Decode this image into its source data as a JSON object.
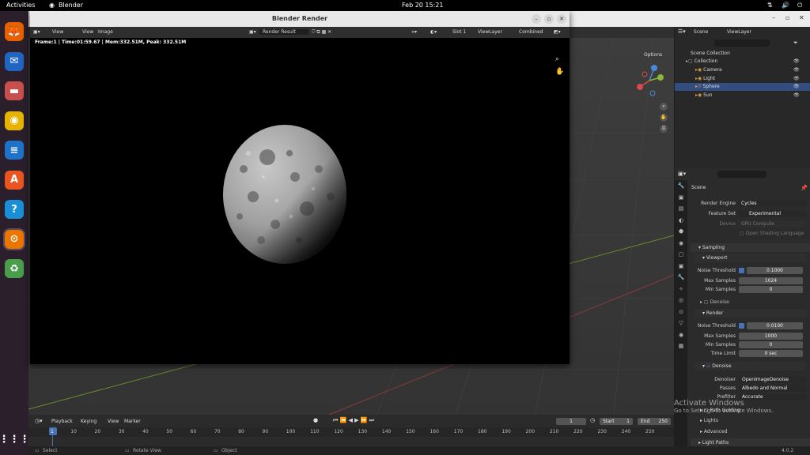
{
  "topbar": {
    "activities": "Activities",
    "app": "Blender",
    "clock": "Feb 20  15:21"
  },
  "dock": [
    {
      "name": "firefox",
      "glyph": "🦊",
      "color": "#e66000"
    },
    {
      "name": "thunderbird",
      "glyph": "✉",
      "color": "#1f65c1"
    },
    {
      "name": "files",
      "glyph": "▬",
      "color": "#c94e4e"
    },
    {
      "name": "rhythmbox",
      "glyph": "◉",
      "color": "#e7b300"
    },
    {
      "name": "writer",
      "glyph": "≡",
      "color": "#1e73c8"
    },
    {
      "name": "app-center",
      "glyph": "A",
      "color": "#e95420"
    },
    {
      "name": "help",
      "glyph": "?",
      "color": "#1a8fd8"
    },
    {
      "name": "blender",
      "glyph": "⊙",
      "color": "#ea7600"
    },
    {
      "name": "trash",
      "glyph": "♻",
      "color": "#4a9d4a"
    },
    {
      "name": "show-apps",
      "glyph": "⋮⋮⋮",
      "color": "transparent"
    }
  ],
  "render_window": {
    "title": "Blender Render",
    "menu": [
      "View",
      "View",
      "Image"
    ],
    "image_name": "Render Result",
    "slot": "Slot 1",
    "view_layer": "ViewLayer",
    "pass": "Combined",
    "stats": "Frame:1 | Time:01:59.67 | Mem:332.51M, Peak: 332.51M"
  },
  "main_window": {
    "min": "–",
    "max": "▫",
    "close": "✕"
  },
  "viewport": {
    "options": "Options",
    "gizmo_labels": [
      "Z",
      "Y",
      "X"
    ]
  },
  "outliner": {
    "scene": "Scene",
    "view_layer": "ViewLayer",
    "rows": [
      {
        "label": "Scene Collection",
        "indent": 0
      },
      {
        "label": "Collection",
        "indent": 1
      },
      {
        "label": "Camera",
        "indent": 2
      },
      {
        "label": "Light",
        "indent": 2
      },
      {
        "label": "Sphere",
        "indent": 2,
        "selected": true
      },
      {
        "label": "Sun",
        "indent": 2
      }
    ]
  },
  "properties": {
    "scene": "Scene",
    "render_engine_label": "Render Engine",
    "render_engine": "Cycles",
    "feature_set_label": "Feature Set",
    "feature_set": "Experimental",
    "device_label": "Device",
    "device": "GPU Compute",
    "osl": "Open Shading Language",
    "sampling": "Sampling",
    "viewport": "Viewport",
    "noise_threshold_label": "Noise Threshold",
    "vp_noise_threshold": "0.1000",
    "max_samples_label": "Max Samples",
    "vp_max_samples": "1024",
    "min_samples_label": "Min Samples",
    "vp_min_samples": "0",
    "denoise_label": "Denoise",
    "render": "Render",
    "r_noise_threshold": "0.0100",
    "r_max_samples": "1000",
    "r_min_samples": "0",
    "time_limit_label": "Time Limit",
    "time_limit": "0 sec",
    "denoiser_label": "Denoiser",
    "denoiser": "OpenImageDenoise",
    "passes_label": "Passes",
    "passes": "Albedo and Normal",
    "prefilter_label": "Prefilter",
    "prefilter": "Accurate",
    "path_guiding": "Path Guiding",
    "lights": "Lights",
    "advanced": "Advanced",
    "light_paths": "Light Paths"
  },
  "timeline": {
    "menus": [
      "Playback",
      "Keying",
      "View",
      "Marker"
    ],
    "current_frame": "1",
    "start_label": "Start",
    "start": "1",
    "end_label": "End",
    "end": "250",
    "ticks": [
      "1",
      "10",
      "20",
      "30",
      "40",
      "50",
      "60",
      "70",
      "80",
      "90",
      "100",
      "110",
      "120",
      "130",
      "140",
      "150",
      "160",
      "170",
      "180",
      "190",
      "200",
      "210",
      "220",
      "230",
      "240",
      "250"
    ]
  },
  "statusbar": {
    "select": "Select",
    "rotate": "Rotate View",
    "object": "Object",
    "version": "4.0.2"
  },
  "watermark": {
    "line1": "Activate Windows",
    "line2": "Go to Settings to activate Windows."
  }
}
